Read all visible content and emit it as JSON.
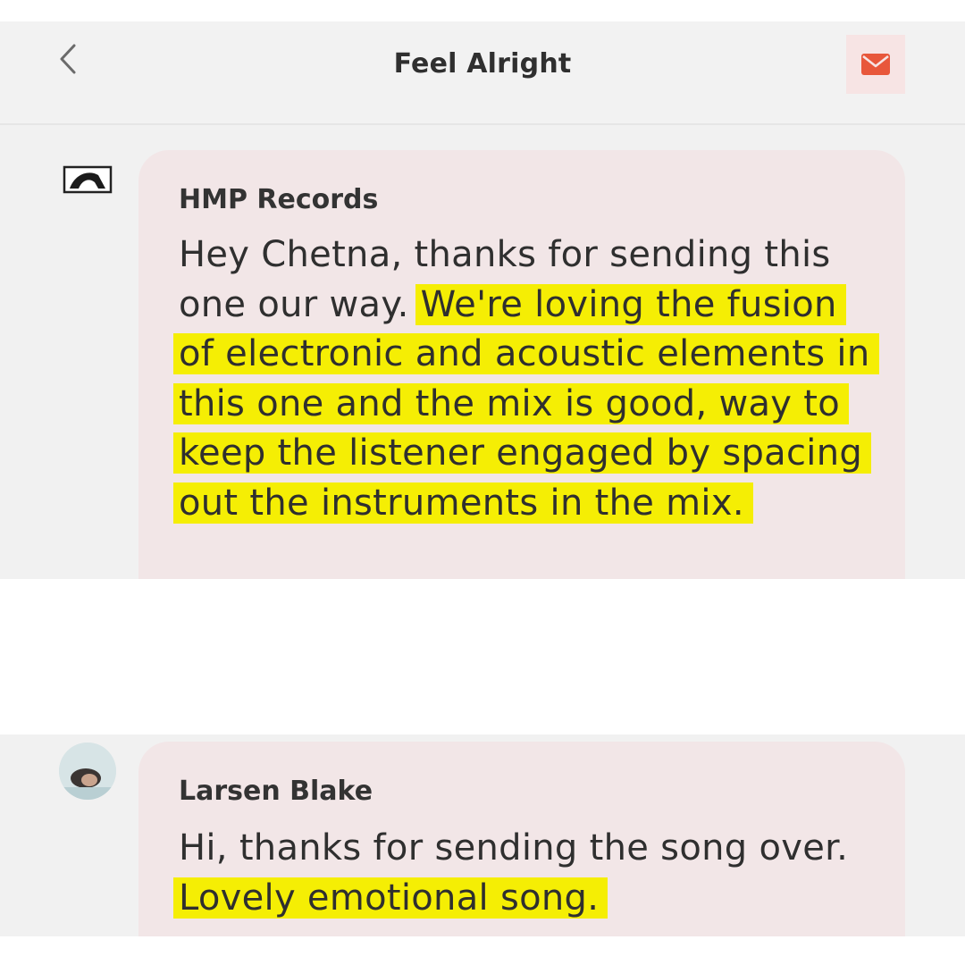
{
  "header": {
    "title": "Feel Alright",
    "back_icon": "chevron-left-icon",
    "mail_icon": "mail-icon",
    "accent": "#e8573b"
  },
  "messages": [
    {
      "sender": "HMP Records",
      "avatar_icon": "label-logo",
      "text_plain": "Hey Chetna, thanks for sending this one our way. ",
      "text_highlight": "We're loving the fusion of electronic and acoustic elements in this one and the mix is good, way to keep the listener engaged by spacing out the instruments in the mix."
    },
    {
      "sender": "Larsen Blake",
      "avatar_icon": "user-photo-avatar",
      "text_plain": "Hi, thanks for sending the song over. ",
      "text_highlight": "Lovely emotional song."
    }
  ],
  "colors": {
    "highlight": "#f5ee04",
    "bubble": "#f2e6e7",
    "background": "#f1f1f1"
  }
}
